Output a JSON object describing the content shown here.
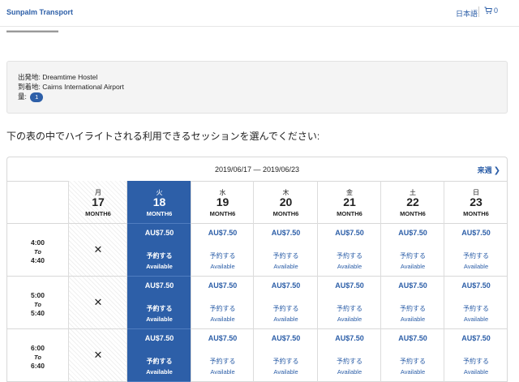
{
  "header": {
    "brand": "Sunpalm Transport",
    "language": "日本語",
    "cart_count": "0"
  },
  "info": {
    "departure": "出発地: Dreamtime Hostel",
    "arrival": "到着地: Cairns International Airport",
    "quantity_label": "量:",
    "quantity": "1"
  },
  "instruction": "下の表の中でハイライトされる利用できるセッションを選んでください:",
  "calendar": {
    "range": "2019/06/17 — 2019/06/23",
    "next_label": "来週",
    "days": [
      {
        "dow": "月",
        "date": "17",
        "month": "MONTH6"
      },
      {
        "dow": "火",
        "date": "18",
        "month": "MONTH6"
      },
      {
        "dow": "水",
        "date": "19",
        "month": "MONTH6"
      },
      {
        "dow": "木",
        "date": "20",
        "month": "MONTH6"
      },
      {
        "dow": "金",
        "date": "21",
        "month": "MONTH6"
      },
      {
        "dow": "土",
        "date": "22",
        "month": "MONTH6"
      },
      {
        "dow": "日",
        "date": "23",
        "month": "MONTH6"
      }
    ],
    "sessions": [
      {
        "start": "4:00",
        "to": "To",
        "end": "4:40"
      },
      {
        "start": "5:00",
        "to": "To",
        "end": "5:40"
      },
      {
        "start": "6:00",
        "to": "To",
        "end": "6:40"
      }
    ],
    "unavailable_mark": "✕",
    "price": "AU$7.50",
    "book_label": "予約する",
    "available_label": "Available"
  },
  "colors": {
    "accent": "#2d5fa8",
    "info_bg": "#f4f4f4"
  },
  "icons": {
    "cart": "cart-icon",
    "next": "chevron-right-icon"
  }
}
